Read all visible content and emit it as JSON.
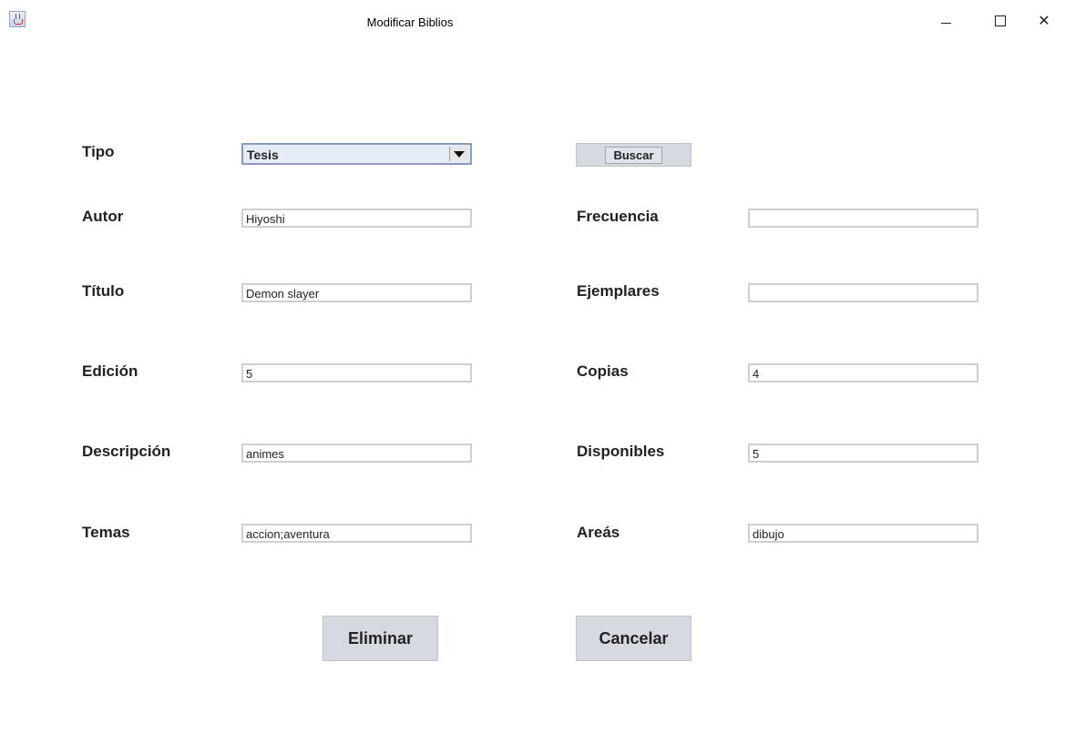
{
  "window": {
    "title": "Modificar Biblios",
    "controls": {
      "minimize": "–",
      "maximize": "□",
      "close": "✕"
    }
  },
  "form": {
    "tipo": {
      "label": "Tipo",
      "selected": "Tesis"
    },
    "buscar_label": "Buscar",
    "left": [
      {
        "key": "autor",
        "label": "Autor",
        "value": "Hiyoshi"
      },
      {
        "key": "titulo",
        "label": "Título",
        "value": "Demon slayer"
      },
      {
        "key": "edicion",
        "label": "Edición",
        "value": "5"
      },
      {
        "key": "descripcion",
        "label": "Descripción",
        "value": "animes"
      },
      {
        "key": "temas",
        "label": "Temas",
        "value": "accion;aventura"
      }
    ],
    "right": [
      {
        "key": "frecuencia",
        "label": "Frecuencia",
        "value": ""
      },
      {
        "key": "ejemplares",
        "label": "Ejemplares",
        "value": ""
      },
      {
        "key": "copias",
        "label": "Copias",
        "value": "4"
      },
      {
        "key": "disponibles",
        "label": "Disponibles",
        "value": "5"
      },
      {
        "key": "areas",
        "label": "Areás",
        "value": "dibujo"
      }
    ]
  },
  "actions": {
    "eliminar_label": "Eliminar",
    "cancelar_label": "Cancelar"
  }
}
